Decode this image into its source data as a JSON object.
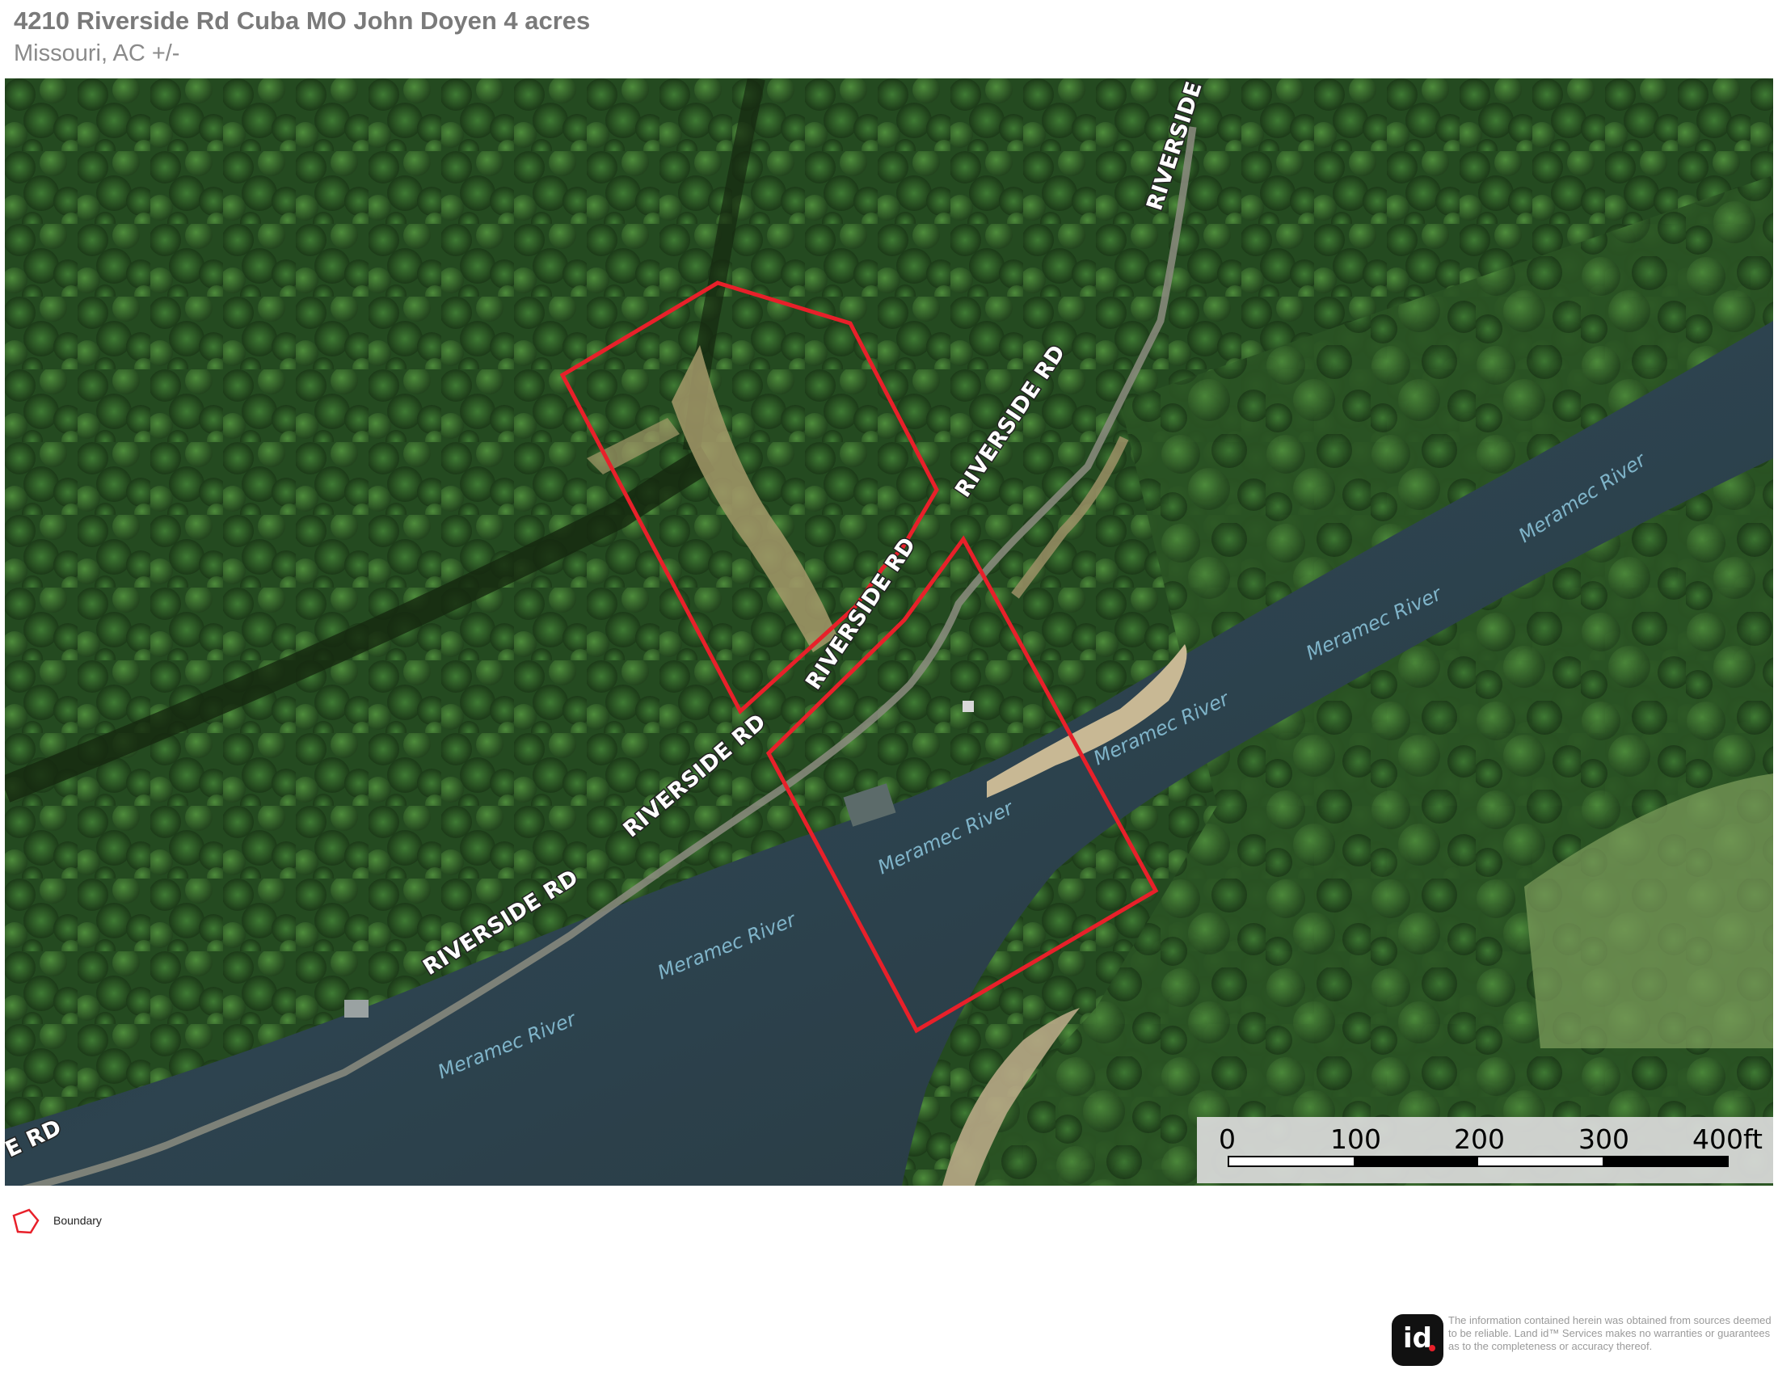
{
  "header": {
    "title": "4210 Riverside Rd Cuba MO John Doyen 4 acres",
    "subtitle": "Missouri,  AC +/-"
  },
  "map": {
    "layer": "aerial imagery",
    "road_labels": [
      {
        "text": "RIVERSIDE RD"
      },
      {
        "text": "RIVERSIDE RD"
      },
      {
        "text": "RIVERSIDE RD"
      },
      {
        "text": "RIVERSIDE RD"
      },
      {
        "text": "RIVERSIDE RD"
      },
      {
        "text": "E RD"
      }
    ],
    "river_labels": [
      {
        "text": "Meramec River"
      },
      {
        "text": "Meramec River"
      },
      {
        "text": "Meramec River"
      },
      {
        "text": "Meramec River"
      },
      {
        "text": "Meramec River"
      },
      {
        "text": "Meramec River"
      }
    ],
    "boundary_color": "#e8202a",
    "vegetation_color": "#2d5a26",
    "river_color": "#2a3c47"
  },
  "scale": {
    "labels": [
      "0",
      "100",
      "200",
      "300",
      "400ft"
    ]
  },
  "legend": {
    "label": "Boundary",
    "icon": "boundary-polygon-icon",
    "color": "#e8202a"
  },
  "footer": {
    "logo_text": "id",
    "disclaimer": "The information contained herein was obtained from sources deemed to be reliable. Land id™ Services makes no warranties or guarantees as to the completeness or accuracy thereof."
  }
}
